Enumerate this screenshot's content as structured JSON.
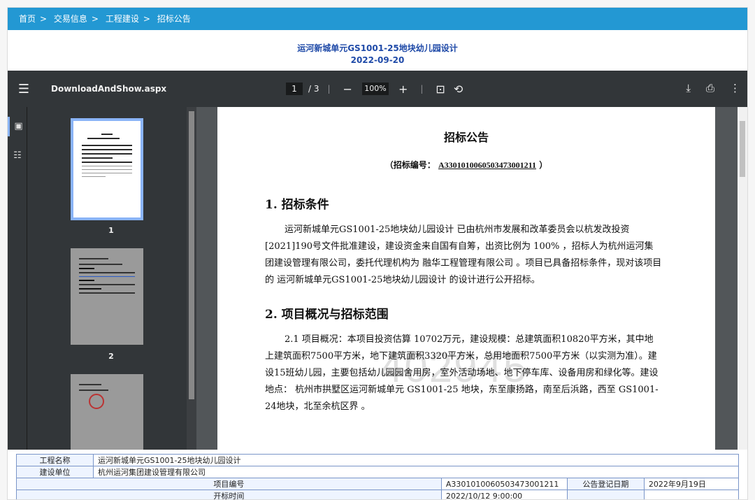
{
  "breadcrumb": {
    "home": "首页",
    "sep": ">",
    "level2": "交易信息",
    "level3": "工程建设",
    "current": "招标公告"
  },
  "header": {
    "title": "运河新城单元GS1001-25地块幼儿园设计",
    "date": "2022-09-20"
  },
  "viewer": {
    "filename": "DownloadAndShow.aspx",
    "page_current": "1",
    "page_total": "/ 3",
    "zoom": "100%",
    "icons": [
      "menu-icon",
      "zoom-out-icon",
      "zoom-in-icon",
      "fit-page-icon",
      "rotate-icon",
      "download-icon",
      "print-icon",
      "more-icon",
      "thumbnail-view-icon",
      "outline-view-icon"
    ],
    "thumb_labels": [
      "1",
      "2"
    ]
  },
  "document": {
    "heading": "招标公告",
    "bid_prefix": "（招标编号：",
    "bid_no": "A3301010060503473001211",
    "bid_suffix": "）",
    "section1_title": "1.  招标条件",
    "section1_text": "运河新城单元GS1001-25地块幼儿园设计 已由杭州市发展和改革委员会以杭发改投资[2021]190号文件批准建设，建设资金来自国有自筹，出资比例为 100% ，招标人为杭州运河集团建设管理有限公司，委托代理机构为 融华工程管理有限公司 。项目已具备招标条件，现对该项目的 运河新城单元GS1001-25地块幼儿园设计 的设计进行公开招标。",
    "section2_title": "2.  项目概况与招标范围",
    "section2_text": "2.1 项目概况：本项目投资估算 10702万元，建设规模：总建筑面积10820平方米，其中地上建筑面积7500平方米，地下建筑面积3320平方米，总用地面积7500平方米（以实测为准）。建设15班幼儿园，主要包括幼儿园园舍用房，室外活动场地、地下停车库、设备用房和绿化等。建设地点： 杭州市拱墅区运河新城单元 GS1001-25 地块，东至康扬路，南至后浜路，西至 GS1001-24地块，北至余杭区界 。",
    "watermark": "402945"
  },
  "info_table": {
    "project_name_label": "工程名称",
    "project_name": "运河新城单元GS1001-25地块幼儿园设计",
    "builder_label": "建设单位",
    "builder": "杭州运河集团建设管理有限公司",
    "project_no_label": "项目编号",
    "project_no": "A3301010060503473001211",
    "reg_date_label": "公告登记日期",
    "reg_date": "2022年9月19日",
    "open_time_label": "开标时间",
    "open_time": "2022/10/12 9:00:00"
  },
  "colors": {
    "breadcrumb_bg": "#2398d3",
    "title_text": "#1f4aa8",
    "viewer_bg": "#525659",
    "toolbar_bg": "#323639"
  }
}
